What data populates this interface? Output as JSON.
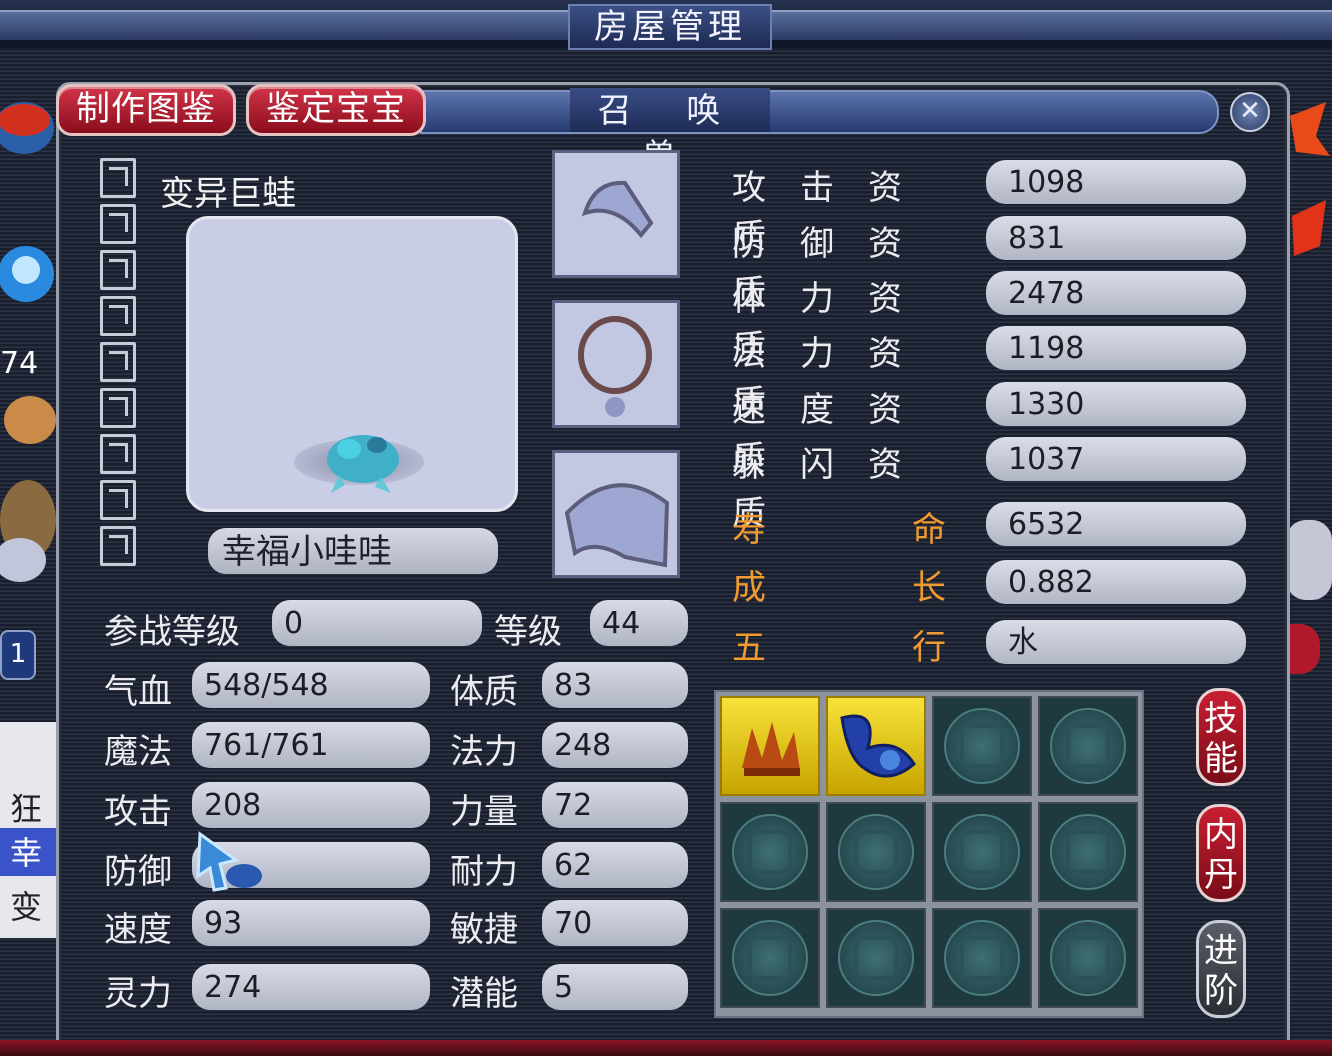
{
  "house_bar": {
    "title": "房屋管理"
  },
  "tabs": [
    {
      "label": "制作图鉴"
    },
    {
      "label": "鉴定宝宝"
    }
  ],
  "panel": {
    "title": "召 唤 兽",
    "close": "✕"
  },
  "pet": {
    "species": "变异巨蛙",
    "nickname": "幸福小哇哇"
  },
  "left_stats": {
    "battle_level": {
      "label": "参战等级",
      "value": "0"
    },
    "level": {
      "label": "等级",
      "value": "44"
    },
    "hp": {
      "label": "气血",
      "value": "548/548"
    },
    "mp": {
      "label": "魔法",
      "value": "761/761"
    },
    "attack": {
      "label": "攻击",
      "value": "208"
    },
    "defense": {
      "label": "防御",
      "value": ""
    },
    "speed": {
      "label": "速度",
      "value": "93"
    },
    "spirit": {
      "label": "灵力",
      "value": "274"
    },
    "constitution": {
      "label": "体质",
      "value": "83"
    },
    "magic": {
      "label": "法力",
      "value": "248"
    },
    "strength": {
      "label": "力量",
      "value": "72"
    },
    "endurance": {
      "label": "耐力",
      "value": "62"
    },
    "agility": {
      "label": "敏捷",
      "value": "70"
    },
    "potential": {
      "label": "潜能",
      "value": "5"
    }
  },
  "aptitudes": [
    {
      "label": "攻击资质",
      "value": "1098"
    },
    {
      "label": "防御资质",
      "value": "831"
    },
    {
      "label": "体力资质",
      "value": "2478"
    },
    {
      "label": "法力资质",
      "value": "1198"
    },
    {
      "label": "速度资质",
      "value": "1330"
    },
    {
      "label": "躲闪资质",
      "value": "1037"
    }
  ],
  "extra": {
    "lifespan": {
      "label_a": "寿",
      "label_b": "命",
      "value": "6532"
    },
    "growth": {
      "label_a": "成",
      "label_b": "长",
      "value": "0.882"
    },
    "element": {
      "label_a": "五",
      "label_b": "行",
      "value": "水"
    }
  },
  "side_buttons": [
    {
      "label": "技能"
    },
    {
      "label": "内丹"
    },
    {
      "label": "进阶"
    }
  ],
  "left_edge": {
    "number": "74",
    "items": [
      "狂",
      "幸",
      "变"
    ],
    "page": "1"
  },
  "colors": {
    "accent_red": "#b0192c",
    "label_orange": "#f09a30",
    "skill_gold": "#f2d82a"
  }
}
